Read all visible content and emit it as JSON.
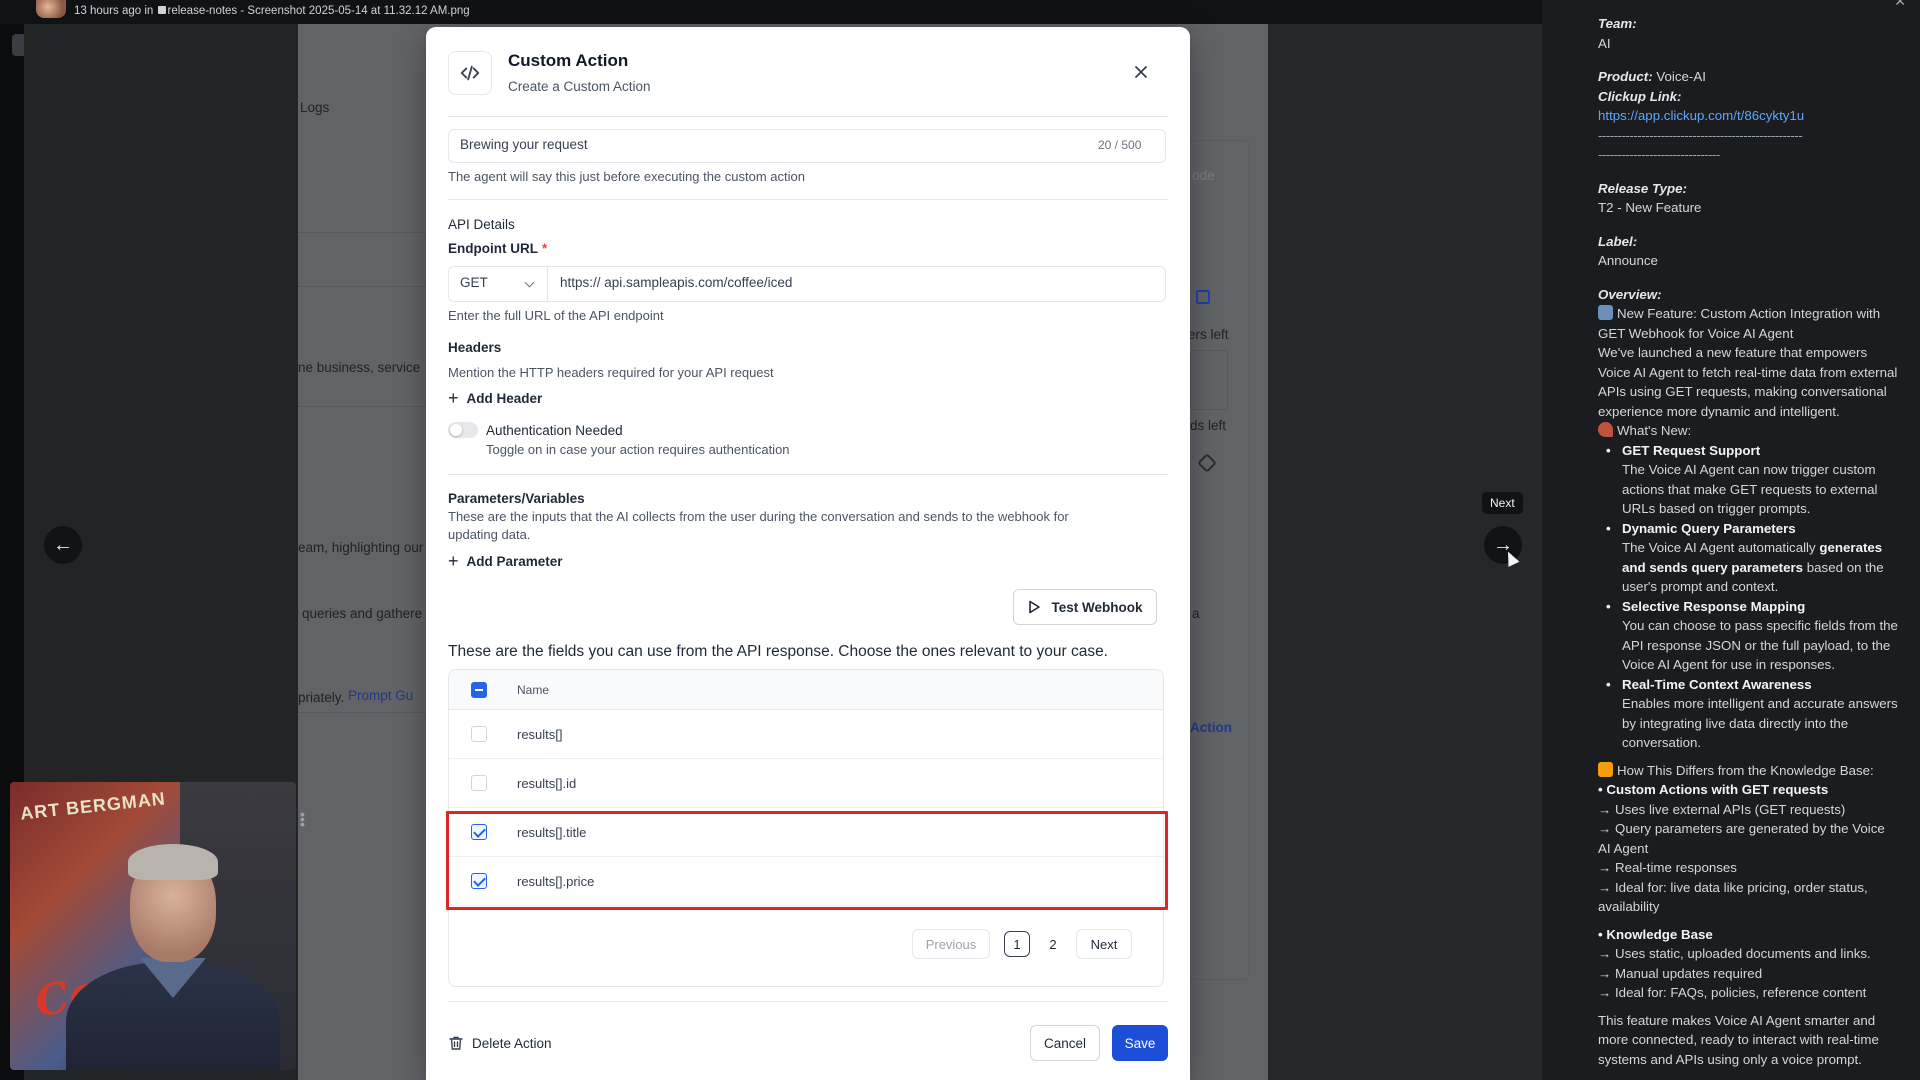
{
  "viewer": {
    "meta_time": "13 hours ago in",
    "meta_channel": "release-notes",
    "meta_file": "- Screenshot 2025-05-14 at 11.32.12 AM.png",
    "next_tooltip": "Next"
  },
  "background": {
    "logs": "Logs",
    "line1": "ne business, service",
    "line2": "eam, highlighting our",
    "line3": "queries and gathere",
    "line4": "priately.",
    "prompt_link": "Prompt Gu",
    "chars_left_1": "ers left",
    "chars_left_2": "ds left",
    "mode": "ode",
    "a": "a",
    "action": "Action"
  },
  "modal": {
    "title": "Custom Action",
    "subtitle": "Create a Custom Action",
    "message": {
      "value": "Brewing your request",
      "counter": "20 / 500",
      "hint": "The agent will say this just before executing the custom action"
    },
    "api": {
      "section": "API Details",
      "endpoint_label": "Endpoint URL",
      "required_mark": "*",
      "method": "GET",
      "url": "https:// api.sampleapis.com/coffee/iced",
      "hint": "Enter the full URL of the API endpoint"
    },
    "headers": {
      "title": "Headers",
      "hint": "Mention the HTTP headers required for your API request",
      "add": "Add Header"
    },
    "auth": {
      "label": "Authentication Needed",
      "hint": "Toggle on in case your action requires authentication"
    },
    "params": {
      "title": "Parameters/Variables",
      "hint1": "These are the inputs that the AI collects from the user during the conversation and sends to the webhook for",
      "hint2": "updating data.",
      "add": "Add Parameter"
    },
    "test_webhook": "Test Webhook",
    "fields_title": "These are the fields you can use from the API response. Choose the ones relevant to your case.",
    "table": {
      "header": "Name",
      "rows": [
        {
          "name": "results[]",
          "checked": false
        },
        {
          "name": "results[].id",
          "checked": false
        },
        {
          "name": "results[].title",
          "checked": true
        },
        {
          "name": "results[].price",
          "checked": true
        }
      ]
    },
    "pagination": {
      "previous": "Previous",
      "page1": "1",
      "page2": "2",
      "next": "Next"
    },
    "footer": {
      "delete": "Delete Action",
      "cancel": "Cancel",
      "save": "Save"
    }
  },
  "webcam": {
    "poster_top": "ART BERGMAN",
    "poster_script": "Casabl"
  },
  "notes": {
    "team_label": "Team:",
    "team": "AI",
    "product_label": "Product:",
    "product": "Voice-AI",
    "clickup_label": "Clickup Link:",
    "clickup_url": "https://app.clickup.com/t/86cykty1u",
    "dashes1": "----------------------------------------------------",
    "dashes2": "-------------------------------",
    "release_type_label": "Release Type:",
    "release_type": "T2 - New Feature",
    "label_label": "Label:",
    "label": "Announce",
    "overview_label": "Overview:",
    "overview_title": "New Feature: Custom Action Integration with GET Webhook for Voice AI Agent",
    "overview_text": "We've launched a new feature that empowers Voice AI Agent to fetch real-time data from external APIs using GET requests, making conversational experience more dynamic and intelligent.",
    "whats_new": "What's New:",
    "f1_title": "GET Request Support",
    "f1_text": "The Voice AI Agent can now trigger custom actions that make GET requests to external URLs based on trigger prompts.",
    "f2_title": "Dynamic Query Parameters",
    "f2_text_a": "The Voice AI Agent automatically",
    "f2_text_b": "generates and sends query parameters",
    "f2_text_c": "based on the user's prompt and context.",
    "f3_title": "Selective Response Mapping",
    "f3_text": "You can choose to pass specific fields from the API response JSON or the full payload, to the Voice AI Agent for use in responses.",
    "f4_title": "Real-Time Context Awareness",
    "f4_text": "Enables more intelligent and accurate answers by integrating live data directly into the conversation.",
    "diff_title": "How This Differs from the Knowledge Base:",
    "ca_title": "• Custom Actions with GET requests",
    "ca_1": "→ Uses live external APIs (GET requests)",
    "ca_2": "→ Query parameters are generated by the Voice AI Agent",
    "ca_3": "→ Real-time responses",
    "ca_4": "→ Ideal for: live data like pricing, order status, availability",
    "kb_title": "• Knowledge Base",
    "kb_1": "→ Uses static, uploaded documents and links.",
    "kb_2": "→ Manual updates required",
    "kb_3": "→ Ideal for: FAQs, policies, reference content",
    "closing": "This feature makes Voice AI Agent smarter and more connected, ready to interact with real-time systems and APIs using only a voice prompt."
  },
  "colors": {
    "primary": "#1d4ed8",
    "highlight": "#dc2626",
    "link": "#60a5fa"
  }
}
